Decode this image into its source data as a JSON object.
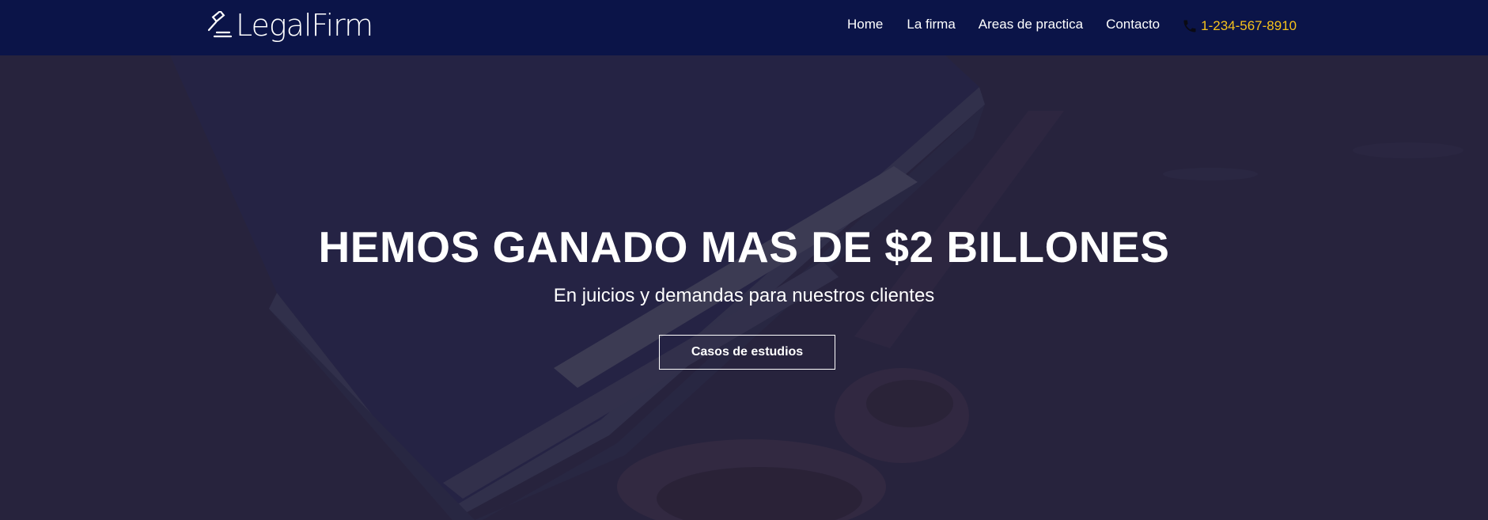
{
  "brand": {
    "name": "LegalFirm",
    "icon": "gavel-icon"
  },
  "nav": {
    "items": [
      {
        "label": "Home"
      },
      {
        "label": "La firma"
      },
      {
        "label": "Areas de practica"
      },
      {
        "label": "Contacto"
      }
    ],
    "phone": {
      "icon": "phone-icon",
      "number": "1-234-567-8910"
    }
  },
  "hero": {
    "title": "HEMOS GANADO MAS DE $2 BILLONES",
    "subtitle": "En juicios y demandas para nuestros clientes",
    "button_label": "Casos de estudios"
  },
  "colors": {
    "navbar_bg": "#0b1448",
    "hero_overlay": "#2a2640",
    "phone_text": "#f6c21b",
    "text": "#ffffff"
  }
}
